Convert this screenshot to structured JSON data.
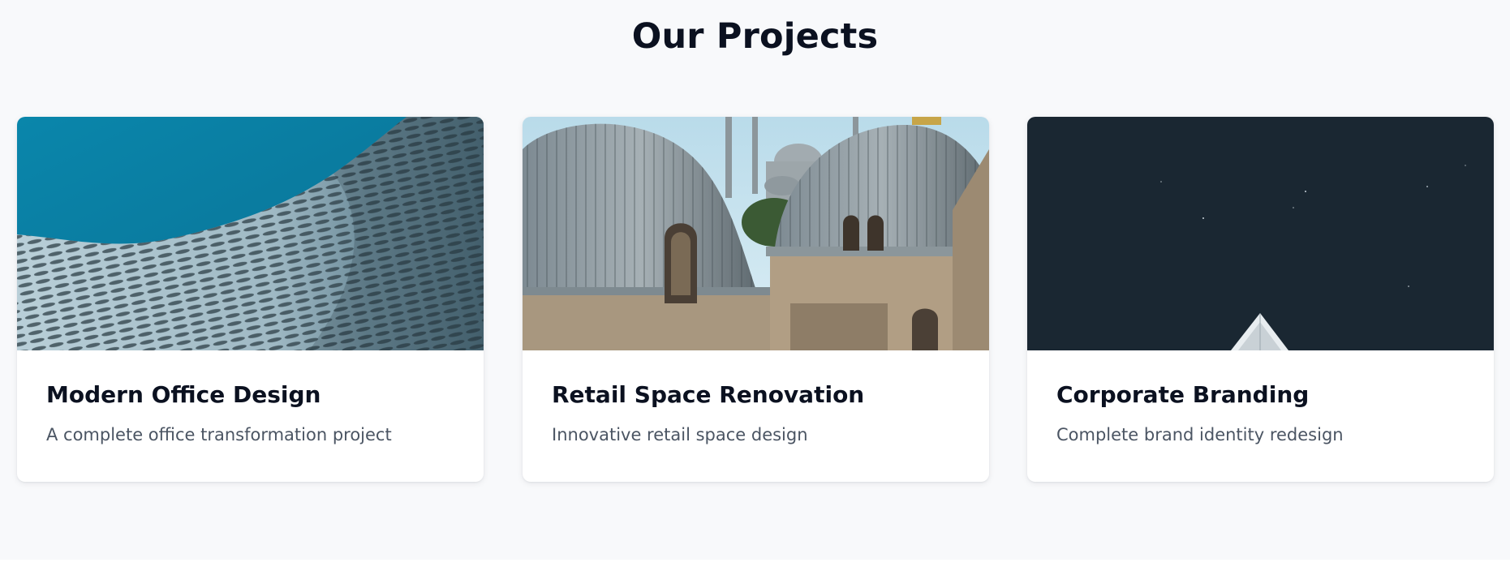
{
  "section": {
    "title": "Our Projects"
  },
  "projects": [
    {
      "title": "Modern Office Design",
      "description": "A complete office transformation project",
      "image": "architectural-facade-photo"
    },
    {
      "title": "Retail Space Renovation",
      "description": "Innovative retail space design",
      "image": "domed-mosque-rooftops-photo"
    },
    {
      "title": "Corporate Branding",
      "description": "Complete brand identity redesign",
      "image": "night-sky-rooftop-photo"
    }
  ],
  "colors": {
    "background": "#f8f9fb",
    "title": "#0b1120",
    "description": "#4b5563",
    "card": "#ffffff"
  }
}
